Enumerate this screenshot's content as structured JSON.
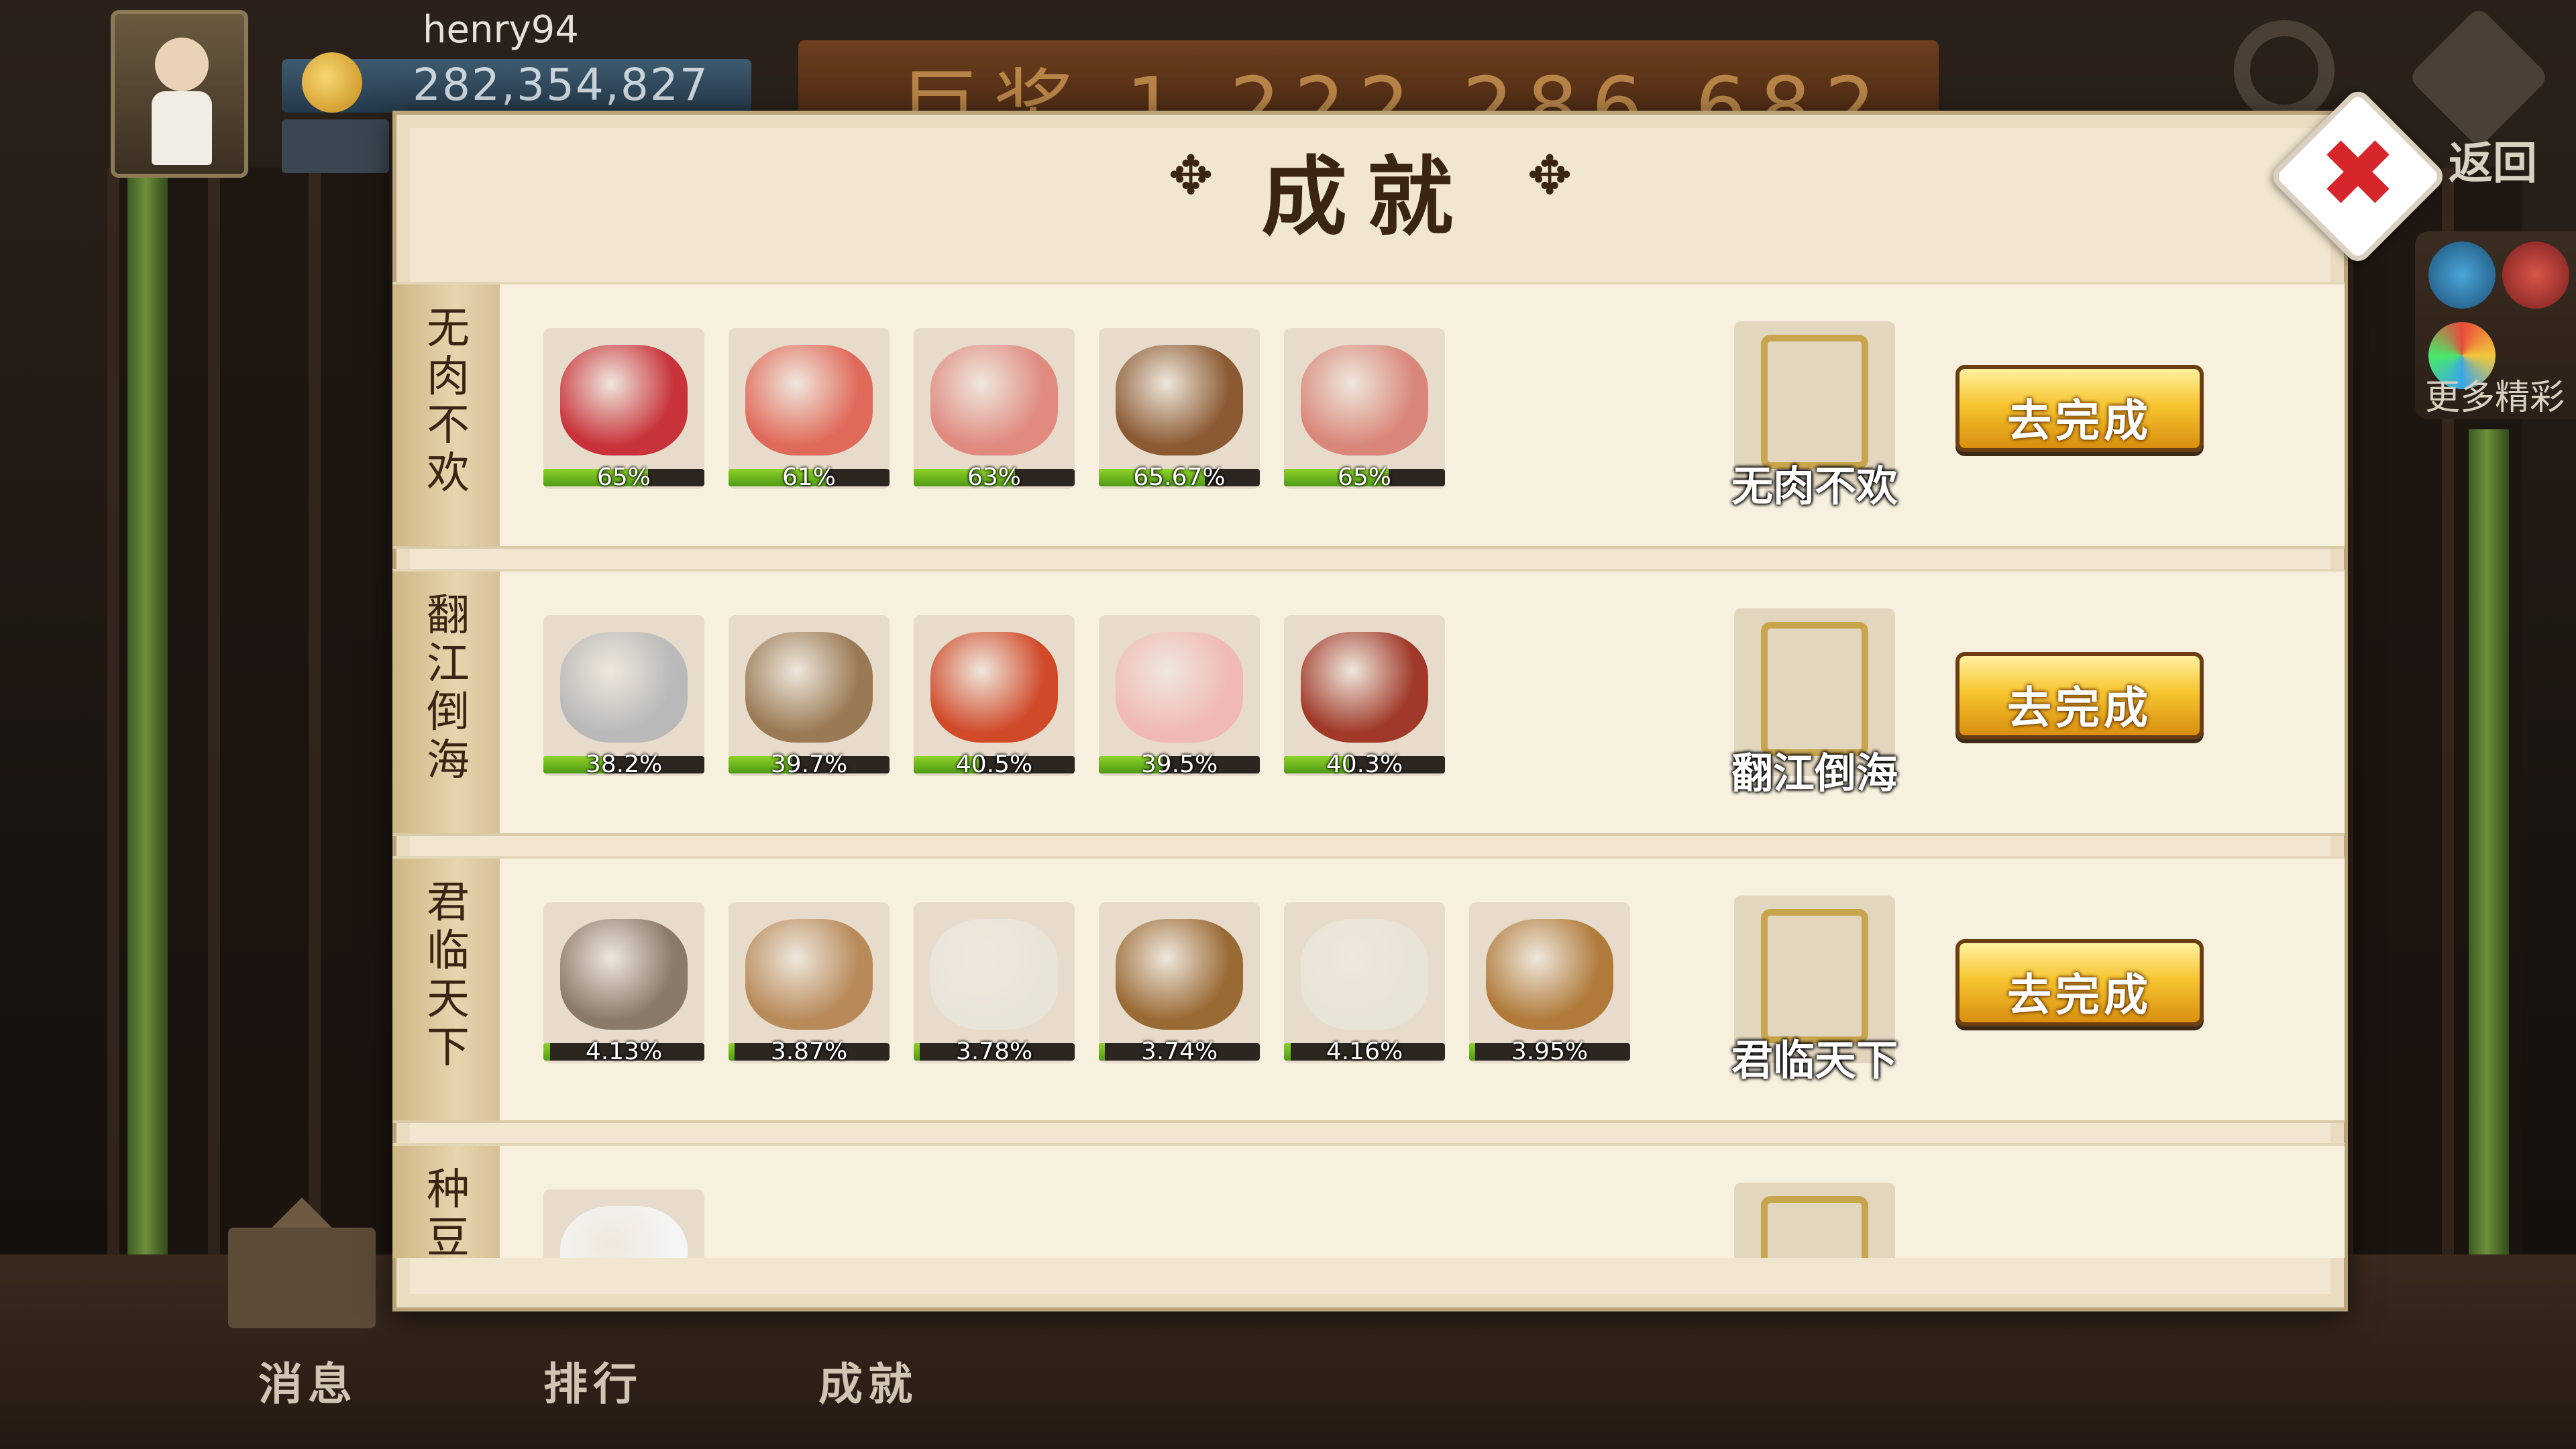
{
  "hud": {
    "username": "henry94",
    "coins": "282,354,827",
    "banner": "巨奖 1,222,286,682",
    "back_label": "返回",
    "more_label": "更多精彩"
  },
  "dialog": {
    "title": "成就",
    "title_ornament": "✥",
    "close_icon": "✖"
  },
  "rows": [
    {
      "label": "无肉不欢",
      "reward_name": "无肉不欢",
      "button": "去完成",
      "items": [
        {
          "icon": "beef-roll-icon",
          "pct_text": "65%",
          "pct": 65,
          "color": "#c8323a"
        },
        {
          "icon": "lamb-roll-icon",
          "pct_text": "61%",
          "pct": 61,
          "color": "#e06a5a"
        },
        {
          "icon": "ham-slice-icon",
          "pct_text": "63%",
          "pct": 63,
          "color": "#e08a80"
        },
        {
          "icon": "tripe-icon",
          "pct_text": "65.67%",
          "pct": 65.67,
          "color": "#8b5a33"
        },
        {
          "icon": "pork-belly-icon",
          "pct_text": "65%",
          "pct": 65,
          "color": "#d9877a"
        }
      ]
    },
    {
      "label": "翻江倒海",
      "reward_name": "翻江倒海",
      "button": "去完成",
      "items": [
        {
          "icon": "shrimp-icon",
          "pct_text": "38.2%",
          "pct": 38.2,
          "color": "#b9b9b9"
        },
        {
          "icon": "abalone-icon",
          "pct_text": "39.7%",
          "pct": 39.7,
          "color": "#9a7a55"
        },
        {
          "icon": "crab-icon",
          "pct_text": "40.5%",
          "pct": 40.5,
          "color": "#d04a2a"
        },
        {
          "icon": "shrimp-ball-icon",
          "pct_text": "39.5%",
          "pct": 39.5,
          "color": "#f0b9b5"
        },
        {
          "icon": "octopus-icon",
          "pct_text": "40.3%",
          "pct": 40.3,
          "color": "#a0392a"
        }
      ]
    },
    {
      "label": "君临天下",
      "reward_name": "君临天下",
      "button": "去完成",
      "items": [
        {
          "icon": "oyster-mushroom-icon",
          "pct_text": "4.13%",
          "pct": 4.13,
          "color": "#8a7a6a"
        },
        {
          "icon": "shimeji-mushroom-icon",
          "pct_text": "3.87%",
          "pct": 3.87,
          "color": "#b88a5a"
        },
        {
          "icon": "king-oyster-mushroom-icon",
          "pct_text": "3.78%",
          "pct": 3.78,
          "color": "#e9e4da"
        },
        {
          "icon": "tea-tree-mushroom-icon",
          "pct_text": "3.74%",
          "pct": 3.74,
          "color": "#9a6a35"
        },
        {
          "icon": "enoki-mushroom-icon",
          "pct_text": "4.16%",
          "pct": 4.16,
          "color": "#e8e4d6"
        },
        {
          "icon": "matsutake-mushroom-icon",
          "pct_text": "3.95%",
          "pct": 3.95,
          "color": "#b07a3a"
        }
      ]
    },
    {
      "label": "种豆",
      "reward_name": "",
      "button": "",
      "items": [
        {
          "icon": "tofu-icon",
          "pct_text": "",
          "pct": 0,
          "color": "#f5f5f5"
        }
      ]
    }
  ],
  "nav": {
    "messages": "消息",
    "ranking": "排行",
    "achievements": "成就"
  }
}
